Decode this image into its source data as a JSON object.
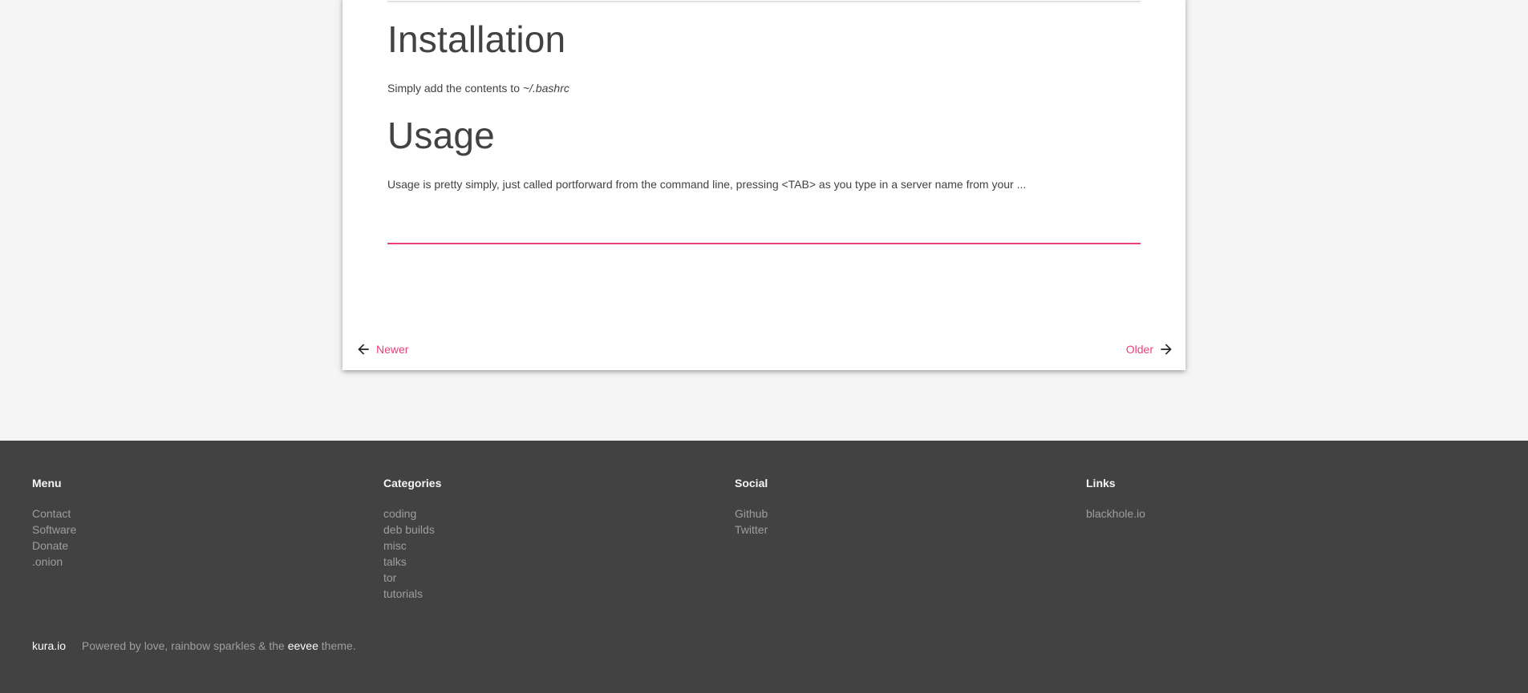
{
  "article": {
    "installation": {
      "heading": "Installation",
      "text_prefix": "Simply add the contents to ",
      "text_file": "~/.bashrc"
    },
    "usage": {
      "heading": "Usage",
      "text": "Usage is pretty simply, just called portforward from the command line, pressing <TAB> as you type in a server name from your ..."
    },
    "accent_color": "#ec407a"
  },
  "pagination": {
    "newer_label": "Newer",
    "older_label": "Older",
    "newer_icon": "arrow-left-icon",
    "older_icon": "arrow-right-icon"
  },
  "footer": {
    "menu": {
      "title": "Menu",
      "items": [
        "Contact",
        "Software",
        "Donate",
        ".onion"
      ]
    },
    "categories": {
      "title": "Categories",
      "items": [
        "coding",
        "deb builds",
        "misc",
        "talks",
        "tor",
        "tutorials"
      ]
    },
    "social": {
      "title": "Social",
      "items": [
        "Github",
        "Twitter"
      ]
    },
    "links": {
      "title": "Links",
      "items": [
        "blackhole.io"
      ]
    },
    "copyright": {
      "brand": "kura.io",
      "powered_prefix": "Powered by love, rainbow sparkles & the ",
      "theme_name": "eevee",
      "powered_suffix": " theme."
    },
    "background_color": "#424242"
  }
}
